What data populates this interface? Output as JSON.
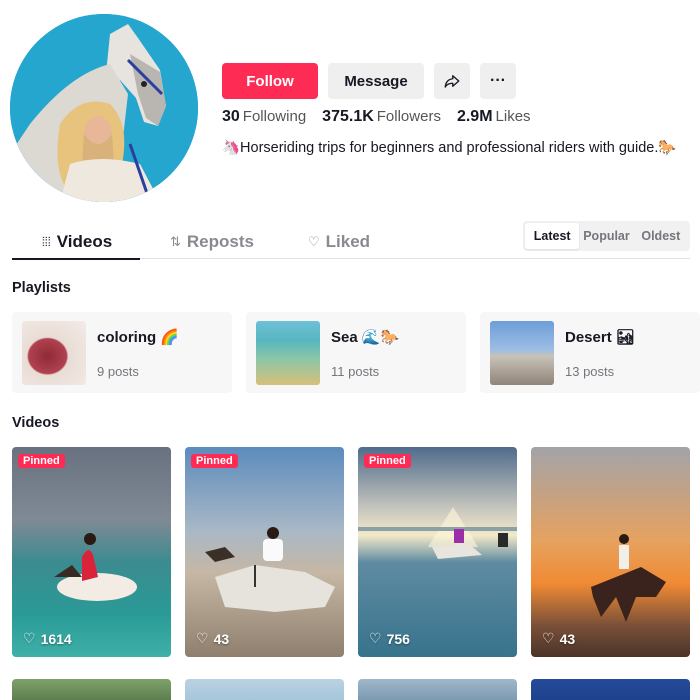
{
  "profile": {
    "bio": "🦄Horseriding trips for beginners and professional riders with guide.🐎"
  },
  "actions": {
    "follow_label": "Follow",
    "message_label": "Message",
    "share_icon": "share-icon",
    "more_icon": "more-icon",
    "more_label": "···"
  },
  "stats": [
    {
      "value": "30",
      "label": "Following"
    },
    {
      "value": "375.1K",
      "label": "Followers"
    },
    {
      "value": "2.9M",
      "label": "Likes"
    }
  ],
  "tabs": [
    {
      "label": "Videos",
      "icon": "grid-icon",
      "active": true
    },
    {
      "label": "Reposts",
      "icon": "repost-icon",
      "active": false
    },
    {
      "label": "Liked",
      "icon": "heart-lock-icon",
      "active": false
    }
  ],
  "sort": [
    {
      "label": "Latest",
      "active": true
    },
    {
      "label": "Popular",
      "active": false
    },
    {
      "label": "Oldest",
      "active": false
    }
  ],
  "playlists_title": "Playlists",
  "playlists": [
    {
      "name": "coloring 🌈",
      "count": "9 posts"
    },
    {
      "name": "Sea 🌊🐎",
      "count": "11 posts"
    },
    {
      "name": "Desert 🏜",
      "count": "13 posts"
    }
  ],
  "videos_title": "Videos",
  "videos": [
    {
      "pinned": "Pinned",
      "likes": "1614"
    },
    {
      "pinned": "Pinned",
      "likes": "43"
    },
    {
      "pinned": "Pinned",
      "likes": "756"
    },
    {
      "pinned": null,
      "likes": "43"
    }
  ],
  "colors": {
    "accent": "#fe2c55",
    "text": "#161823",
    "muted": "#75767c",
    "chip": "#efefef"
  }
}
